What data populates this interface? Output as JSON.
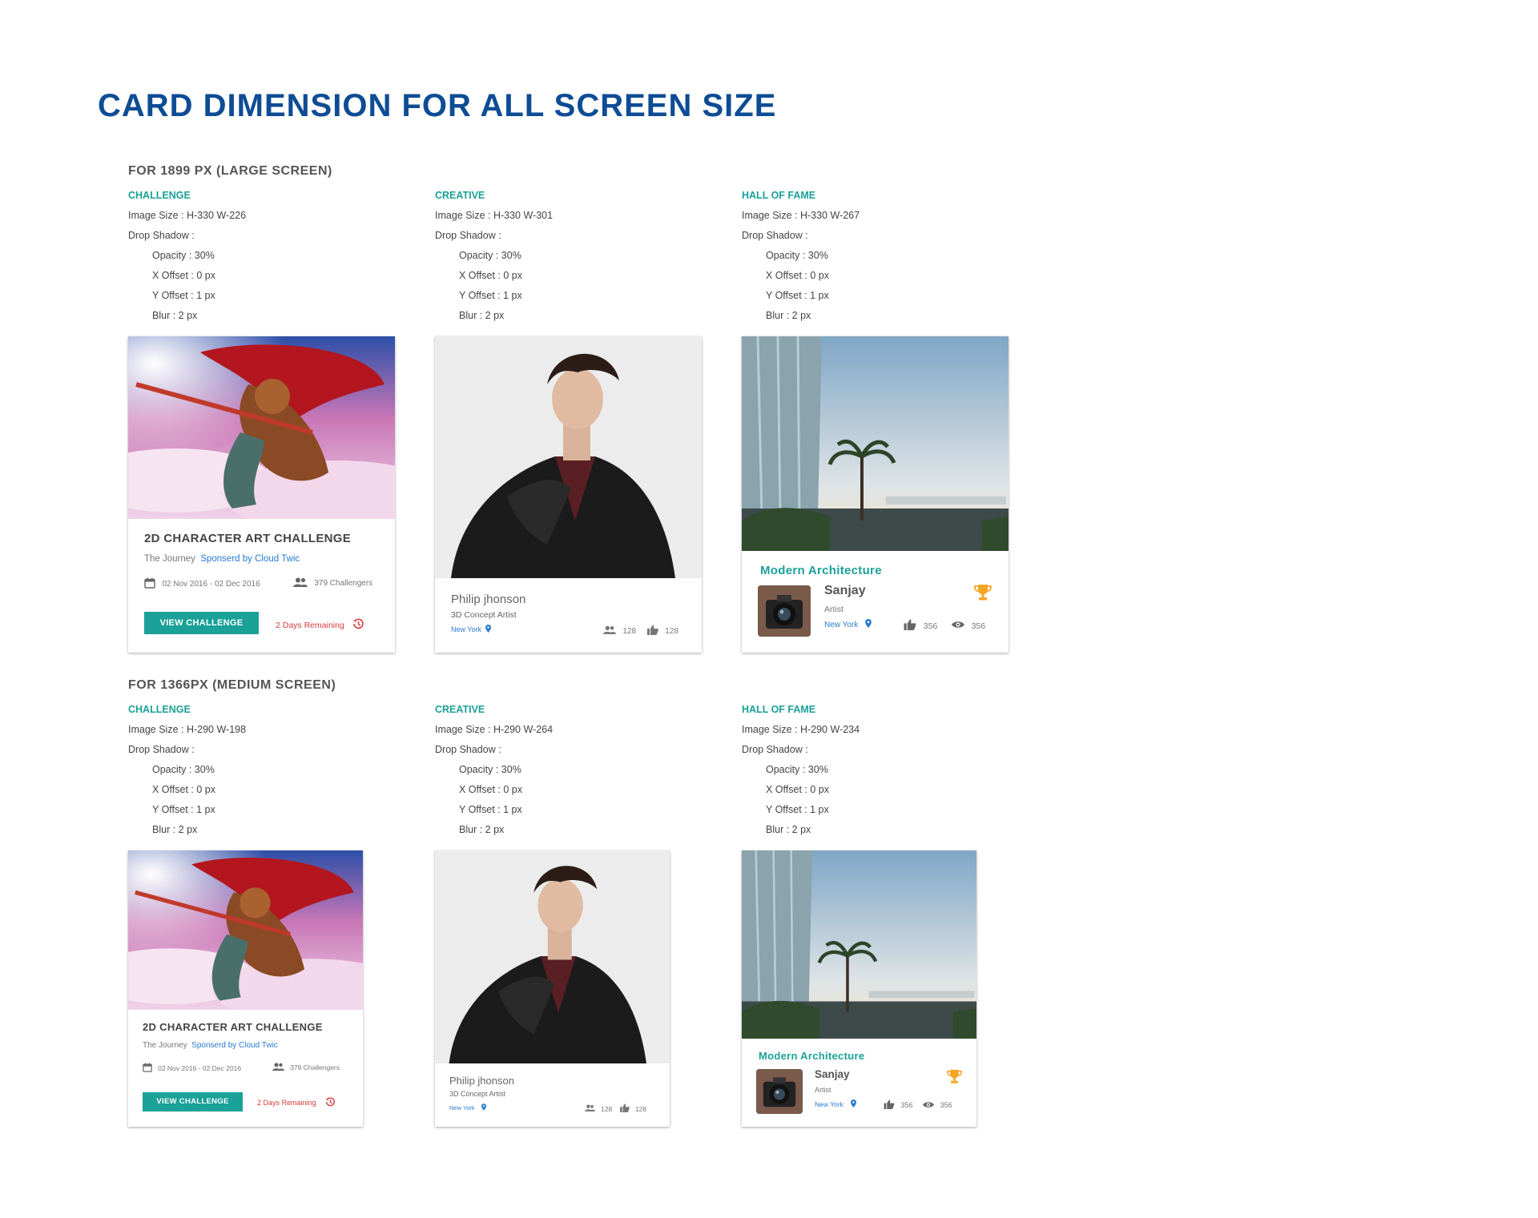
{
  "page_title": "CARD DIMENSION FOR ALL SCREEN SIZE",
  "sections": [
    {
      "title": "FOR 1899 PX (LARGE SCREEN)",
      "specs": [
        {
          "type": "CHALLENGE",
          "image_size": "Image Size :  H-330  W-226"
        },
        {
          "type": "CREATIVE",
          "image_size": "Image Size :  H-330  W-301"
        },
        {
          "type": "HALL OF FAME",
          "image_size": "Image Size :  H-330  W-267"
        }
      ]
    },
    {
      "title": "FOR 1366PX (MEDIUM SCREEN)",
      "specs": [
        {
          "type": "CHALLENGE",
          "image_size": "Image Size :  H-290  W-198"
        },
        {
          "type": "CREATIVE",
          "image_size": "Image Size :  H-290  W-264"
        },
        {
          "type": "HALL OF FAME",
          "image_size": "Image Size :  H-290  W-234"
        }
      ]
    }
  ],
  "shadow": {
    "label": "Drop Shadow :",
    "opacity": "Opacity : 30%",
    "x_offset": "X  Offset : 0 px",
    "y_offset": "Y  Offset : 1 px",
    "blur": "Blur : 2 px"
  },
  "challenge_card": {
    "title": "2D CHARACTER ART CHALLENGE",
    "subtitle_prefix": "The Journey",
    "sponsor": "Sponserd by Cloud Twic",
    "dates": "02 Nov 2016 - 02 Dec 2016",
    "challengers": "379 Challengers",
    "button": "VIEW CHALLENGE",
    "remaining": "2 Days Remaining"
  },
  "creative_card": {
    "name": "Philip jhonson",
    "role": "3D Concept Artist",
    "location": "New York",
    "followers": "128",
    "likes": "128"
  },
  "hall_card": {
    "title": "Modern Architecture",
    "name": "Sanjay",
    "role": "Artist",
    "location": "New York",
    "likes": "356",
    "views": "356"
  },
  "colors": {
    "title_blue": "#0e4c95",
    "teal": "#1aa198",
    "link_blue": "#2a7bd1",
    "red": "#d63b3b",
    "trophy": "#f5a623"
  }
}
